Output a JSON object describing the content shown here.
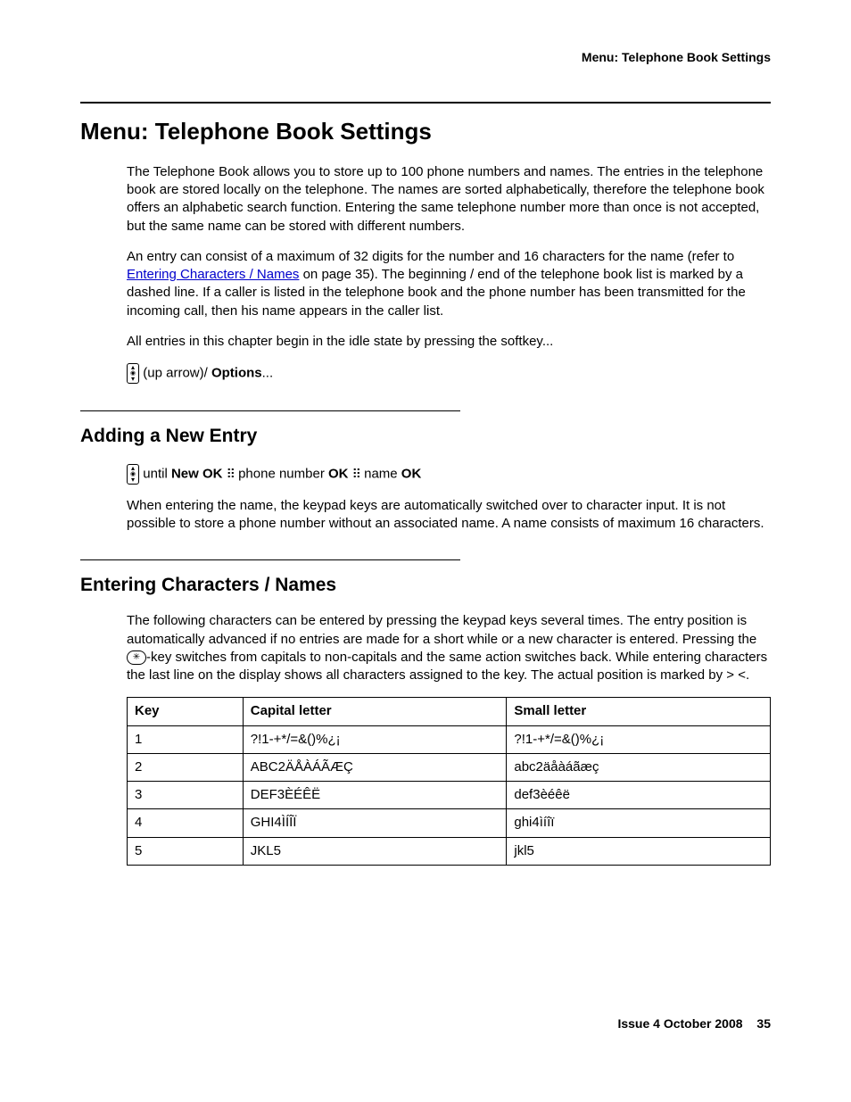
{
  "header": {
    "running": "Menu: Telephone Book Settings"
  },
  "title": "Menu: Telephone Book Settings",
  "intro": {
    "p1": "The Telephone Book allows you to store up to 100 phone numbers and names. The entries in the telephone book are stored locally on the telephone. The names are sorted alphabetically, therefore the telephone book offers an alphabetic search function. Entering the same telephone number more than once is not accepted, but the same name can be stored with different numbers.",
    "p2_a": "An entry can consist of a maximum of 32 digits for the number and 16 characters for the name (refer to ",
    "p2_link": "Entering Characters / Names",
    "p2_b": " on page 35). The beginning / end of the telephone book list is marked by a dashed line. If a caller is listed in the telephone book and the phone number has been transmitted for the incoming call, then his name appears in the caller list.",
    "p3": "All entries in this chapter begin in the idle state by pressing the softkey...",
    "p4_a": " (up arrow)/ ",
    "p4_b": "Options",
    "p4_c": "..."
  },
  "sec1": {
    "title": "Adding a New Entry",
    "line_a": " until ",
    "line_new": "New",
    "line_ok1": " OK  ",
    "line_phone": " phone number ",
    "line_ok2": "OK ",
    "line_name": " name ",
    "line_ok3": "OK",
    "p": "When entering the name, the keypad keys are automatically switched over to character input. It is not possible to store a phone number without an associated name. A name consists of maximum 16 characters."
  },
  "sec2": {
    "title": "Entering Characters / Names",
    "p_a": "The following characters can be entered by pressing the keypad keys several times. The entry position is automatically advanced if no entries are made for a short while or a new character is entered. Pressing the ",
    "p_b": "-key switches from capitals to non-capitals and the same action switches back. While entering characters the last line on the display shows all characters assigned to the key. The actual position is marked by > <."
  },
  "table": {
    "headers": {
      "c1": "Key",
      "c2": "Capital letter",
      "c3": "Small letter"
    },
    "rows": [
      {
        "k": "1",
        "cap": "?!1-+*/=&()%¿¡",
        "small": "?!1-+*/=&()%¿¡"
      },
      {
        "k": "2",
        "cap": "ABC2ÄÅÀÁÃÆÇ",
        "small": "abc2äåàáãæç"
      },
      {
        "k": "3",
        "cap": "DEF3ÈÉÊË",
        "small": "def3èéêë"
      },
      {
        "k": "4",
        "cap": "GHI4ÌÍÎÏ",
        "small": "ghi4ìíîï"
      },
      {
        "k": "5",
        "cap": "JKL5",
        "small": "jkl5"
      }
    ]
  },
  "footer": {
    "issue": "Issue 4   October 2008",
    "page": "35"
  }
}
